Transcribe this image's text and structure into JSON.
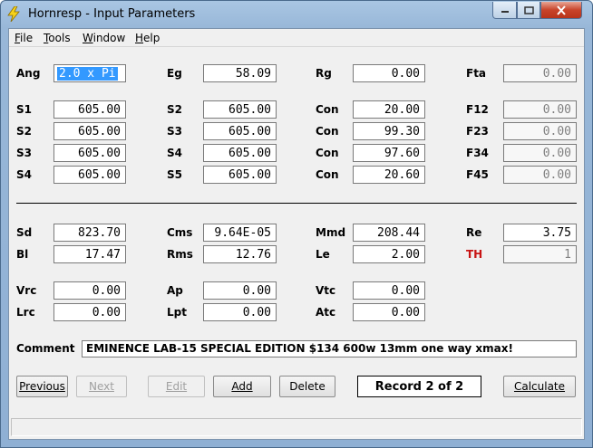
{
  "window": {
    "title": "Hornresp - Input Parameters"
  },
  "menu": [
    {
      "key": "F",
      "rest": "ile"
    },
    {
      "key": "T",
      "rest": "ools"
    },
    {
      "key": "W",
      "rest": "indow"
    },
    {
      "key": "H",
      "rest": "elp"
    }
  ],
  "params": {
    "ang": {
      "label": "Ang",
      "value": "2.0 x Pi"
    },
    "eg": {
      "label": "Eg",
      "value": "58.09"
    },
    "rg": {
      "label": "Rg",
      "value": "0.00"
    },
    "fta": {
      "label": "Fta",
      "value": "0.00"
    },
    "s1": {
      "label": "S1",
      "value": "605.00"
    },
    "s2a": {
      "label": "S2",
      "value": "605.00"
    },
    "con1": {
      "label": "Con",
      "value": "20.00"
    },
    "f12": {
      "label": "F12",
      "value": "0.00"
    },
    "s2": {
      "label": "S2",
      "value": "605.00"
    },
    "s3a": {
      "label": "S3",
      "value": "605.00"
    },
    "con2": {
      "label": "Con",
      "value": "99.30"
    },
    "f23": {
      "label": "F23",
      "value": "0.00"
    },
    "s3": {
      "label": "S3",
      "value": "605.00"
    },
    "s4a": {
      "label": "S4",
      "value": "605.00"
    },
    "con3": {
      "label": "Con",
      "value": "97.60"
    },
    "f34": {
      "label": "F34",
      "value": "0.00"
    },
    "s4": {
      "label": "S4",
      "value": "605.00"
    },
    "s5": {
      "label": "S5",
      "value": "605.00"
    },
    "con4": {
      "label": "Con",
      "value": "20.60"
    },
    "f45": {
      "label": "F45",
      "value": "0.00"
    },
    "sd": {
      "label": "Sd",
      "value": "823.70"
    },
    "cms": {
      "label": "Cms",
      "value": "9.64E-05"
    },
    "mmd": {
      "label": "Mmd",
      "value": "208.44"
    },
    "re": {
      "label": "Re",
      "value": "3.75"
    },
    "bl": {
      "label": "Bl",
      "value": "17.47"
    },
    "rms": {
      "label": "Rms",
      "value": "12.76"
    },
    "le": {
      "label": "Le",
      "value": "2.00"
    },
    "th": {
      "label": "TH",
      "value": "1"
    },
    "vrc": {
      "label": "Vrc",
      "value": "0.00"
    },
    "ap": {
      "label": "Ap",
      "value": "0.00"
    },
    "vtc": {
      "label": "Vtc",
      "value": "0.00"
    },
    "lrc": {
      "label": "Lrc",
      "value": "0.00"
    },
    "lpt": {
      "label": "Lpt",
      "value": "0.00"
    },
    "atc": {
      "label": "Atc",
      "value": "0.00"
    }
  },
  "comment": {
    "label": "Comment",
    "value": "EMINENCE LAB-15 SPECIAL EDITION $134 600w 13mm one way xmax!"
  },
  "buttons": {
    "previous": "Previous",
    "next": "Next",
    "edit": "Edit",
    "add": "Add",
    "delete": "Delete",
    "calculate": "Calculate"
  },
  "record": "Record 2 of 2",
  "colors": {
    "th_label": "#c81414",
    "selection": "#3399ff",
    "close_button": "#c8442a"
  }
}
